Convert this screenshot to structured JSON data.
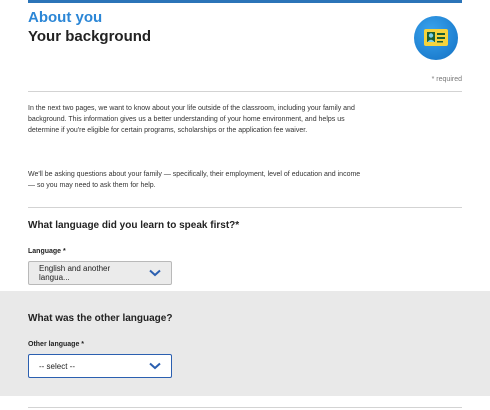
{
  "header": {
    "section_title": "About you",
    "page_title": "Your background",
    "badge_icon": "id-card-icon",
    "accent_color": "#2b86d6"
  },
  "required_note": "* required",
  "intro": {
    "paragraph_1": "In the next two pages, we want to know about your life outside of the classroom, including your family and background. This information gives us a better understanding of your home environment, and helps us determine if you're eligible for certain programs, scholarships or the application fee waiver.",
    "paragraph_2": "We'll be asking questions about your family — specifically, their employment, level of education and income — so you may need to ask them for help."
  },
  "question_first_language": {
    "question": "What language did you learn to speak first?*",
    "label": "Language *",
    "selected_value": "English and another langua..."
  },
  "question_other_language": {
    "question": "What was the other language?",
    "label": "Other language *",
    "selected_value": "-- select --"
  }
}
